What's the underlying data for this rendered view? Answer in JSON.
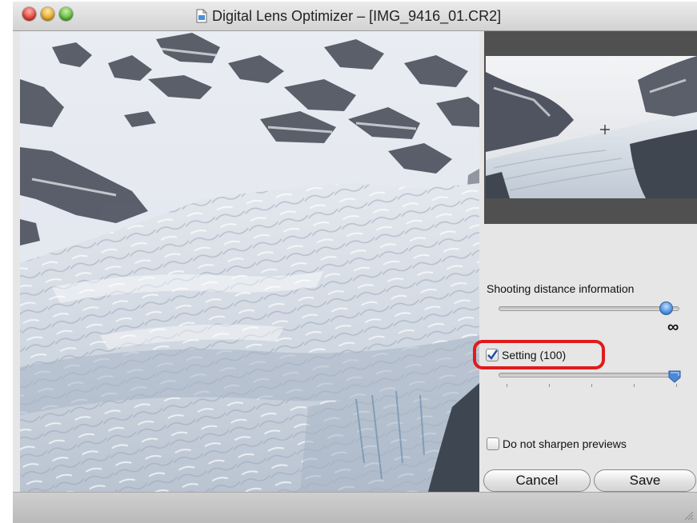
{
  "window": {
    "title": "Digital Lens Optimizer – [IMG_9416_01.CR2]"
  },
  "icons": {
    "close": "close-button-red",
    "minimize": "minimize-button-yellow",
    "zoom": "zoom-button-green",
    "document": "document-icon",
    "crosshair": "crosshair-icon",
    "resize": "resize-grip-icon"
  },
  "panel": {
    "distance_label": "Shooting distance information",
    "distance_value_symbol": "∞",
    "setting_label": "Setting (100)",
    "setting_value": 100,
    "setting_checked": true,
    "no_sharpen_label": "Do not sharpen previews",
    "no_sharpen_checked": false
  },
  "buttons": {
    "cancel": "Cancel",
    "save": "Save"
  },
  "colors": {
    "highlight": "#e01b1b",
    "accent": "#3d83d9"
  }
}
